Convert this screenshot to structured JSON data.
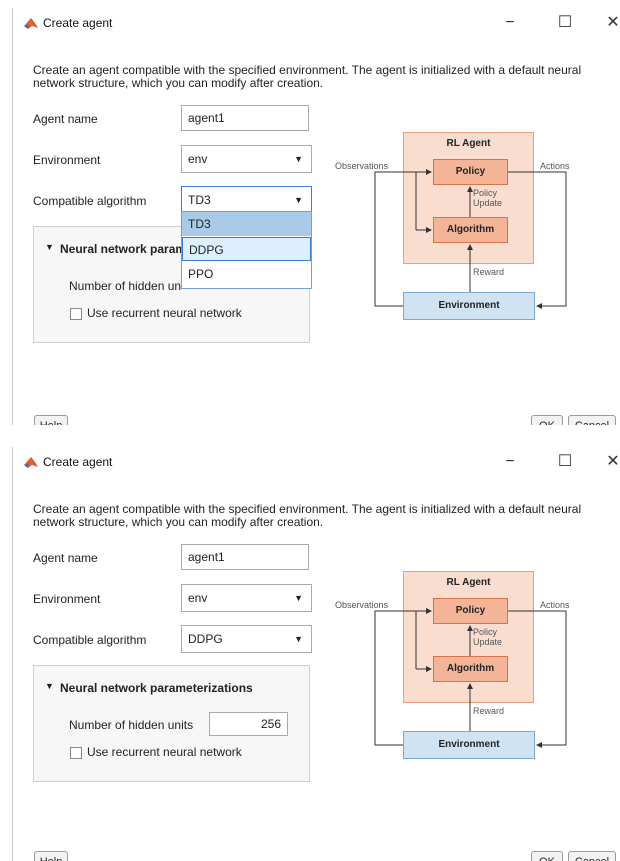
{
  "window": {
    "title": "Create agent",
    "minimize": "−",
    "maximize": "☐",
    "close": "✕"
  },
  "description": "Create an agent compatible with the specified environment. The agent is initialized with a default neural network structure, which you can modify after creation.",
  "form": {
    "agent_name_label": "Agent name",
    "agent_name_value": "agent1",
    "environment_label": "Environment",
    "environment_value": "env",
    "algorithm_label": "Compatible algorithm"
  },
  "screen1": {
    "algorithm_value": "TD3",
    "dropdown_options": [
      "TD3",
      "DDPG",
      "PPO"
    ],
    "dropdown_selected": "TD3",
    "dropdown_hover": "DDPG",
    "panel_title": "Neural network param",
    "hidden_units_label": "Number of hidden un"
  },
  "screen2": {
    "algorithm_value": "DDPG",
    "panel_title": "Neural network parameterizations",
    "hidden_units_label": "Number of hidden units",
    "hidden_units_value": "256"
  },
  "recurrent_label": "Use recurrent neural network",
  "buttons": {
    "help": "Help",
    "ok": "OK",
    "cancel": "Cancel"
  },
  "diagram": {
    "rl_agent": "RL Agent",
    "policy": "Policy",
    "algorithm": "Algorithm",
    "environment": "Environment",
    "observations": "Observations",
    "actions": "Actions",
    "policy_update_line1": "Policy",
    "policy_update_line2": "Update",
    "reward": "Reward"
  },
  "colors": {
    "agent_fill": "#f9ddcf",
    "box_fill": "#f3b497",
    "env_fill": "#cfe3f3",
    "selection": "#a9cbe9",
    "focus": "#3c7fd6"
  }
}
